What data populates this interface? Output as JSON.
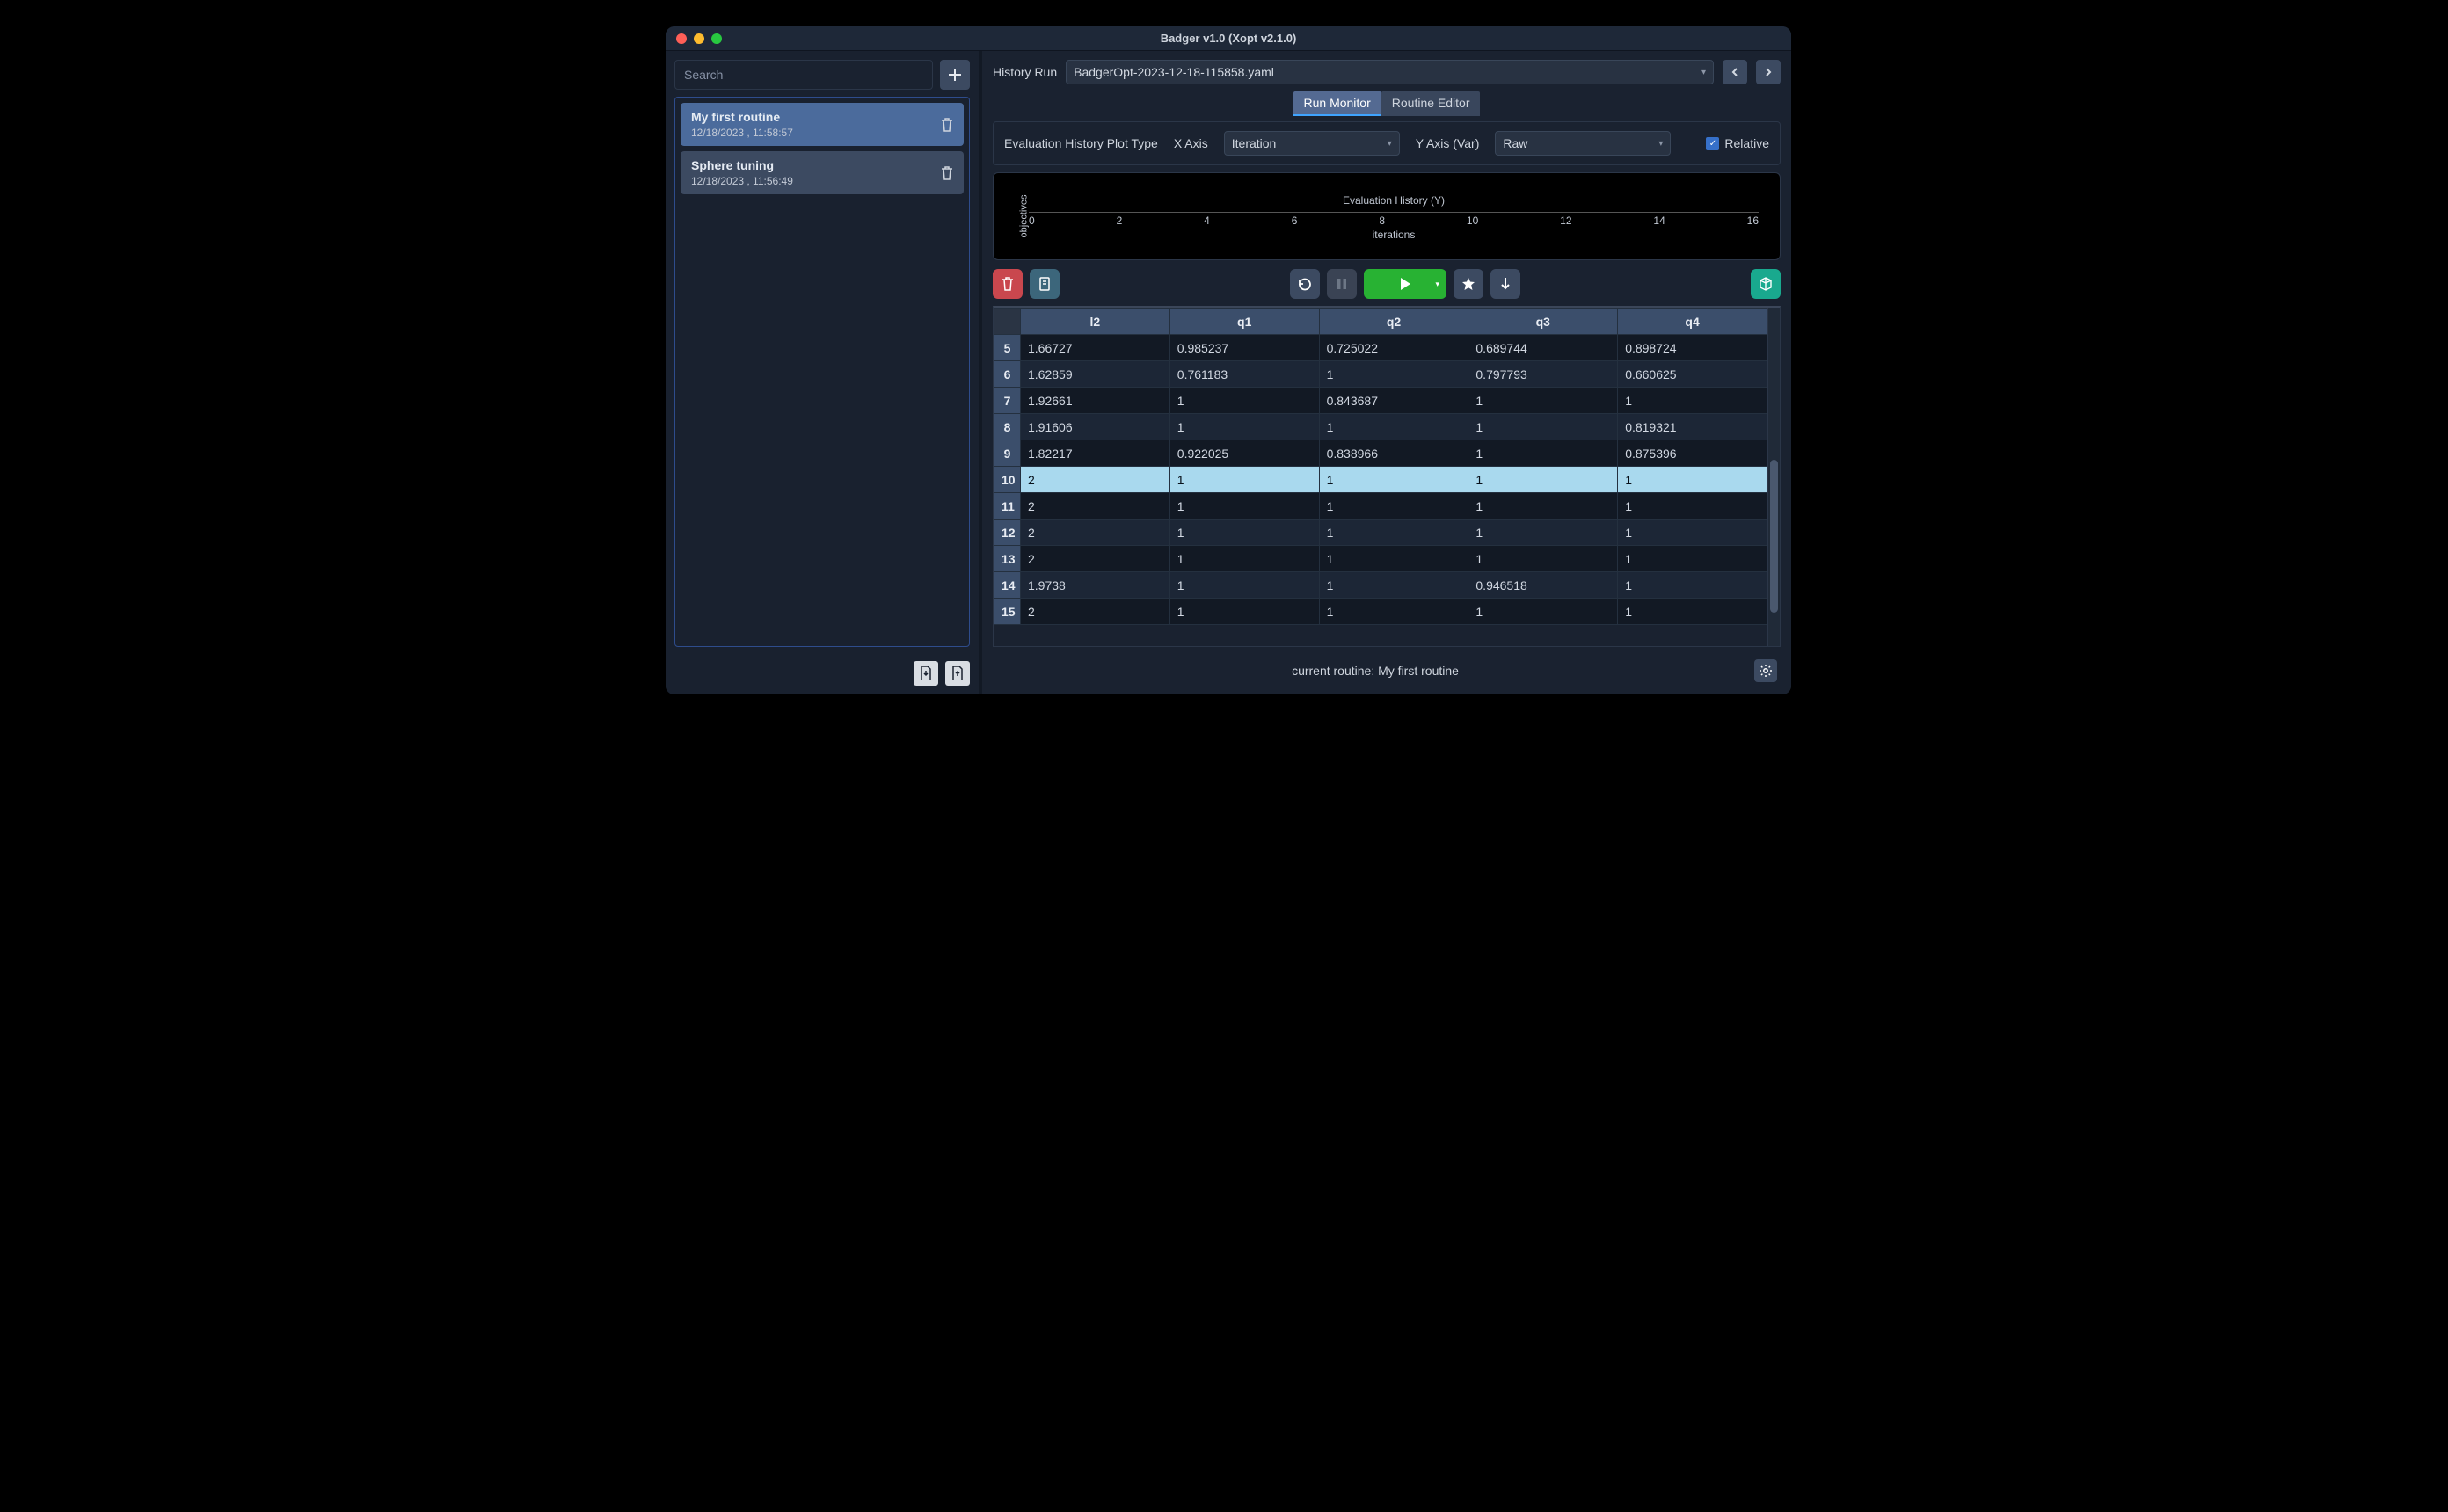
{
  "window_title": "Badger v1.0 (Xopt v2.1.0)",
  "sidebar": {
    "search_placeholder": "Search",
    "add_label": "+",
    "routines": [
      {
        "title": "My first routine",
        "subtitle": "12/18/2023 , 11:58:57",
        "selected": true
      },
      {
        "title": "Sphere tuning",
        "subtitle": "12/18/2023 , 11:56:49",
        "selected": false
      }
    ]
  },
  "history": {
    "label": "History Run",
    "value": "BadgerOpt-2023-12-18-115858.yaml"
  },
  "tabs": {
    "run_monitor": "Run Monitor",
    "routine_editor": "Routine Editor",
    "active": "run_monitor"
  },
  "plot_config": {
    "title_label": "Evaluation History Plot Type",
    "xaxis_label": "X Axis",
    "xaxis_value": "Iteration",
    "yaxis_label": "Y Axis (Var)",
    "yaxis_value": "Raw",
    "relative_label": "Relative",
    "relative_checked": true
  },
  "plot": {
    "ylabel": "objectives",
    "title": "Evaluation History (Y)",
    "xlabel": "iterations",
    "xticks": [
      "0",
      "2",
      "4",
      "6",
      "8",
      "10",
      "12",
      "14",
      "16"
    ]
  },
  "table": {
    "columns": [
      "l2",
      "q1",
      "q2",
      "q3",
      "q4"
    ],
    "highlight_row_index": 5,
    "rows": [
      {
        "idx": "5",
        "cells": [
          "1.66727",
          "0.985237",
          "0.725022",
          "0.689744",
          "0.898724"
        ]
      },
      {
        "idx": "6",
        "cells": [
          "1.62859",
          "0.761183",
          "1",
          "0.797793",
          "0.660625"
        ]
      },
      {
        "idx": "7",
        "cells": [
          "1.92661",
          "1",
          "0.843687",
          "1",
          "1"
        ]
      },
      {
        "idx": "8",
        "cells": [
          "1.91606",
          "1",
          "1",
          "1",
          "0.819321"
        ]
      },
      {
        "idx": "9",
        "cells": [
          "1.82217",
          "0.922025",
          "0.838966",
          "1",
          "0.875396"
        ]
      },
      {
        "idx": "10",
        "cells": [
          "2",
          "1",
          "1",
          "1",
          "1"
        ]
      },
      {
        "idx": "11",
        "cells": [
          "2",
          "1",
          "1",
          "1",
          "1"
        ]
      },
      {
        "idx": "12",
        "cells": [
          "2",
          "1",
          "1",
          "1",
          "1"
        ]
      },
      {
        "idx": "13",
        "cells": [
          "2",
          "1",
          "1",
          "1",
          "1"
        ]
      },
      {
        "idx": "14",
        "cells": [
          "1.9738",
          "1",
          "1",
          "0.946518",
          "1"
        ]
      },
      {
        "idx": "15",
        "cells": [
          "2",
          "1",
          "1",
          "1",
          "1"
        ]
      }
    ]
  },
  "footer": {
    "current_routine_prefix": "current routine: ",
    "current_routine_name": "My first routine"
  },
  "chart_data": {
    "type": "line",
    "title": "Evaluation History (Y)",
    "xlabel": "iterations",
    "ylabel": "objectives",
    "x": [
      0,
      2,
      4,
      6,
      8,
      10,
      12,
      14,
      16
    ],
    "series": [],
    "xlim": [
      0,
      16
    ],
    "note": "placeholder axis only — no data series rendered in screenshot"
  }
}
